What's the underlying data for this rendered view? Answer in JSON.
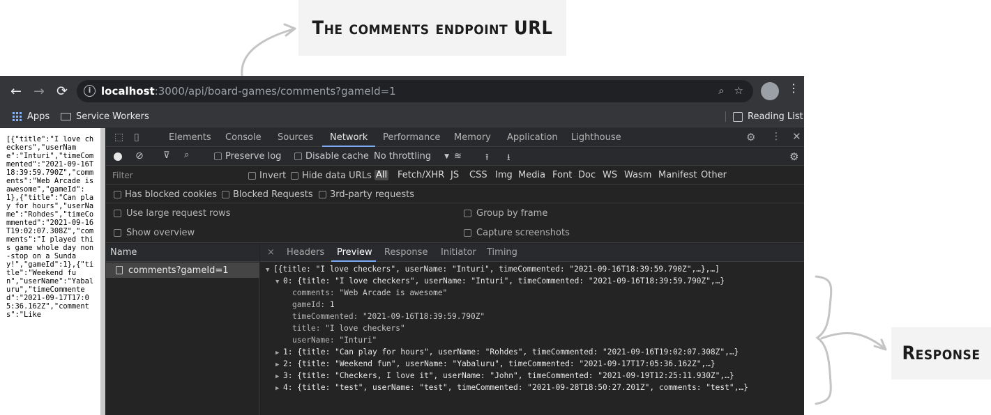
{
  "callouts": {
    "url_label": "The comments endpoint URL",
    "response_label": "Response"
  },
  "browser": {
    "omnibox": {
      "host": "localhost",
      "path": ":3000/api/board-games/comments?gameId=1"
    },
    "bookmarks": {
      "apps": "Apps",
      "service_workers": "Service Workers",
      "reading_list": "Reading List"
    }
  },
  "page": {
    "raw_json": "[{\"title\":\"I love checkers\",\"userName\":\"Inturi\",\"timeCommented\":\"2021-09-16T18:39:59.790Z\",\"comments\":\"Web Arcade is awesome\",\"gameId\":1},{\"title\":\"Can play for hours\",\"userName\":\"Rohdes\",\"timeCommented\":\"2021-09-16T19:02:07.308Z\",\"comments\":\"I played this game whole day non-stop on a Sunday!\",\"gameId\":1},{\"title\":\"Weekend fun\",\"userName\":\"Yabaluru\",\"timeCommented\":\"2021-09-17T17:05:36.162Z\",\"comments\":\"Like"
  },
  "devtools": {
    "tabs": [
      "Elements",
      "Console",
      "Sources",
      "Network",
      "Performance",
      "Memory",
      "Application",
      "Lighthouse"
    ],
    "active_tab": "Network",
    "toolbar": {
      "preserve_log": "Preserve log",
      "disable_cache": "Disable cache",
      "throttling": "No throttling"
    },
    "filter": {
      "placeholder": "Filter",
      "invert": "Invert",
      "hide_data_urls": "Hide data URLs",
      "types": [
        "All",
        "Fetch/XHR",
        "JS",
        "CSS",
        "Img",
        "Media",
        "Font",
        "Doc",
        "WS",
        "Wasm",
        "Manifest",
        "Other"
      ],
      "active_type": "All"
    },
    "blocked": {
      "has_blocked_cookies": "Has blocked cookies",
      "blocked_requests": "Blocked Requests",
      "third_party": "3rd-party requests"
    },
    "options": {
      "large_rows": "Use large request rows",
      "group_by_frame": "Group by frame",
      "show_overview": "Show overview",
      "capture_screenshots": "Capture screenshots"
    },
    "requests": {
      "header": "Name",
      "items": [
        "comments?gameId=1"
      ]
    },
    "detail": {
      "close": "×",
      "tabs": [
        "Headers",
        "Preview",
        "Response",
        "Initiator",
        "Timing"
      ],
      "active_tab": "Preview"
    },
    "preview": {
      "root": "[{title: \"I love checkers\", userName: \"Inturi\", timeCommented: \"2021-09-16T18:39:59.790Z\",…},…]",
      "item0_summary": "0: {title: \"I love checkers\", userName: \"Inturi\", timeCommented: \"2021-09-16T18:39:59.790Z\",…}",
      "item0_fields": [
        {
          "key": "comments",
          "value": "\"Web Arcade is awesome\""
        },
        {
          "key": "gameId",
          "value": "1"
        },
        {
          "key": "timeCommented",
          "value": "\"2021-09-16T18:39:59.790Z\""
        },
        {
          "key": "title",
          "value": "\"I love checkers\""
        },
        {
          "key": "userName",
          "value": "\"Inturi\""
        }
      ],
      "collapsed_items": [
        "1: {title: \"Can play for hours\", userName: \"Rohdes\", timeCommented: \"2021-09-16T19:02:07.308Z\",…}",
        "2: {title: \"Weekend fun\", userName: \"Yabaluru\", timeCommented: \"2021-09-17T17:05:36.162Z\",…}",
        "3: {title: \"Checkers, I love it\", userName: \"John\", timeCommented: \"2021-09-19T12:25:11.930Z\",…}",
        "4: {title: \"test\", userName: \"test\", timeCommented: \"2021-09-28T18:50:27.201Z\", comments: \"test\",…}"
      ]
    }
  }
}
